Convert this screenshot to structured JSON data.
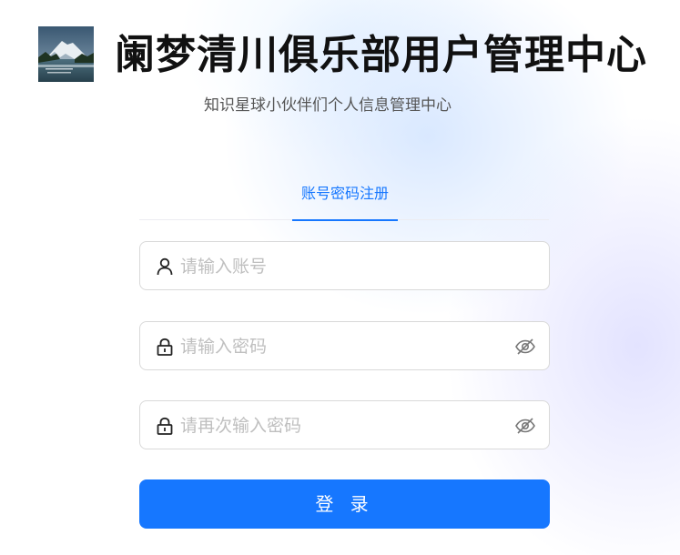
{
  "header": {
    "title": "阑梦清川俱乐部用户管理中心",
    "subtitle": "知识星球小伙伴们个人信息管理中心",
    "logo_icon": "mountain-lake-logo"
  },
  "tabs": [
    {
      "label": "账号密码注册",
      "active": true
    }
  ],
  "form": {
    "account": {
      "placeholder": "请输入账号",
      "value": "",
      "icon": "user-icon"
    },
    "password": {
      "placeholder": "请输入密码",
      "value": "",
      "icon": "lock-icon",
      "toggle_icon": "eye-slash-icon"
    },
    "confirm_password": {
      "placeholder": "请再次输入密码",
      "value": "",
      "icon": "lock-icon",
      "toggle_icon": "eye-slash-icon"
    }
  },
  "submit": {
    "label": "登 录"
  },
  "colors": {
    "accent": "#1677ff",
    "placeholder": "#bfbfbf",
    "border": "#d9d9d9"
  }
}
